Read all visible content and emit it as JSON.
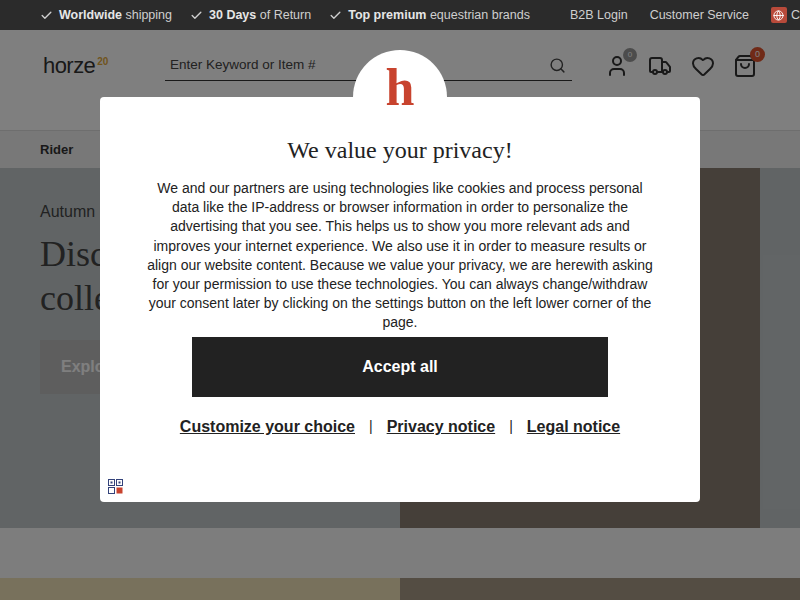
{
  "top_bar": {
    "usps": [
      {
        "bold": "Worldwide",
        "text": " shipping"
      },
      {
        "bold": "30 Days",
        "text": " of Return"
      },
      {
        "bold": "Top premium",
        "text": " equestrian brands"
      }
    ],
    "links": [
      "B2B Login",
      "Customer Service"
    ],
    "language": "C"
  },
  "header": {
    "logo": "horze",
    "logo_badge": "20",
    "search": {
      "placeholder": "Enter Keyword or Item #"
    },
    "account_badge": "0",
    "cart_badge": "0"
  },
  "nav": {
    "items": [
      "Rider"
    ]
  },
  "hero": {
    "eyebrow": "Autumn",
    "title_lines": [
      "Disc",
      "colle"
    ],
    "button": "Explo"
  },
  "consent": {
    "logo_letter": "h",
    "title": "We value your privacy!",
    "body": "We and our partners are using technologies like cookies and process personal data like the IP-address or browser information in order to personalize the advertising that you see. This helps us to show you more relevant ads and improves your internet experience. We also use it in order to measure results or align our website content. Because we value your privacy, we are herewith asking for your permission to use these technologies. You can always change/withdraw your consent later by clicking on the settings button on the left lower corner of the page.",
    "accept_button": "Accept all",
    "links": [
      "Customize your choice",
      "Privacy notice",
      "Legal notice"
    ],
    "separator": "|"
  }
}
